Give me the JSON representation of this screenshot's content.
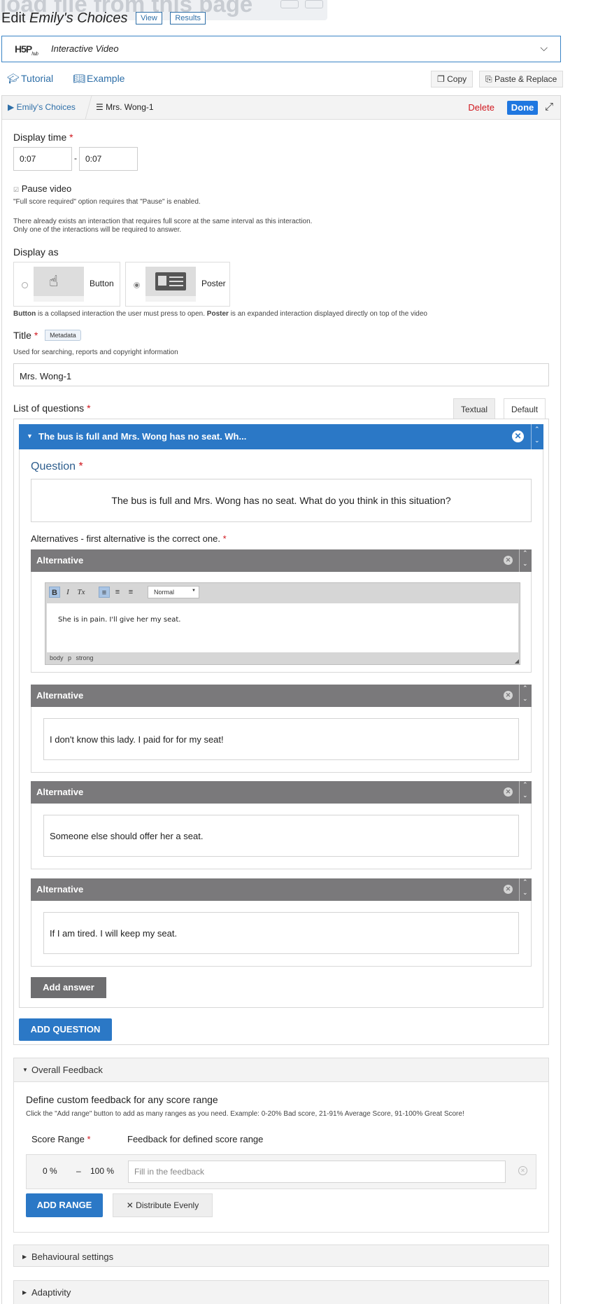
{
  "ghost_header": {
    "text": "load file from this page"
  },
  "page": {
    "edit_prefix": "Edit",
    "content_title": "Emily's Choices",
    "view_label": "View",
    "results_label": "Results"
  },
  "library": {
    "logo_main": "H5P",
    "logo_sub": "hub",
    "name": "Interactive Video"
  },
  "links": {
    "tutorial": "Tutorial",
    "example": "Example"
  },
  "utility": {
    "copy": "Copy",
    "paste_replace": "Paste & Replace"
  },
  "breadcrumb": {
    "root": "Emily's Choices",
    "current": "Mrs. Wong-1",
    "delete": "Delete",
    "done": "Done"
  },
  "form": {
    "display_time": {
      "label": "Display time",
      "from": "0:07",
      "separator": "-",
      "to": "0:07"
    },
    "pause": {
      "label": "Pause video",
      "desc": "\"Full score required\" option requires that \"Pause\" is enabled.",
      "warning1": "There already exists an interaction that requires full score at the same interval as this interaction.",
      "warning2": "Only one of the interactions will be required to answer."
    },
    "display_as": {
      "label": "Display as",
      "options": [
        {
          "label": "Button"
        },
        {
          "label": "Poster"
        }
      ],
      "selected": "Poster",
      "desc_b1": "Button",
      "desc_t1": " is a collapsed interaction the user must press to open. ",
      "desc_b2": "Poster",
      "desc_t2": " is an expanded interaction displayed directly on top of the video"
    },
    "title": {
      "label": "Title",
      "metadata": "Metadata",
      "desc": "Used for searching, reports and copyright information",
      "value": "Mrs. Wong-1"
    },
    "questions": {
      "label": "List of questions",
      "tabs": [
        "Textual",
        "Default"
      ],
      "items": [
        {
          "summary": "The bus is full and Mrs. Wong has no seat. Wh...",
          "question_label": "Question",
          "question_text": "The bus is full and Mrs. Wong has no seat. What do you think in this situation?",
          "alternatives_label": "Alternatives - first alternative is the correct one.",
          "alternatives": [
            {
              "header": "Alternative",
              "text": "She is in pain. I'll give her my seat."
            },
            {
              "header": "Alternative",
              "text": "I don't know this lady. I paid for for my seat!"
            },
            {
              "header": "Alternative",
              "text": "Someone else should offer her a seat."
            },
            {
              "header": "Alternative",
              "text": "If I am tired. I will keep my seat."
            }
          ],
          "editor": {
            "bold": "B",
            "italic": "I",
            "clear": "Tx",
            "format": "Normal",
            "path": "body p strong"
          },
          "add_answer": "Add answer"
        }
      ],
      "add_question": "ADD QUESTION"
    },
    "overall_feedback": {
      "label": "Overall Feedback",
      "title": "Define custom feedback for any score range",
      "desc": "Click the \"Add range\" button to add as many ranges as you need. Example: 0-20% Bad score, 21-91% Average Score, 91-100% Great Score!",
      "score_range_label": "Score Range",
      "feedback_label": "Feedback for defined score range",
      "range_from": "0 %",
      "range_sep": "–",
      "range_to": "100 %",
      "feedback_placeholder": "Fill in the feedback",
      "add_range": "ADD RANGE",
      "distribute": "Distribute Evenly"
    },
    "behavioural_label": "Behavioural settings",
    "adaptivity_label": "Adaptivity"
  },
  "colors": {
    "accent": "#2b78c6",
    "done": "#1f77e0",
    "required": "#d0161d",
    "alt_header": "#7a797b"
  }
}
